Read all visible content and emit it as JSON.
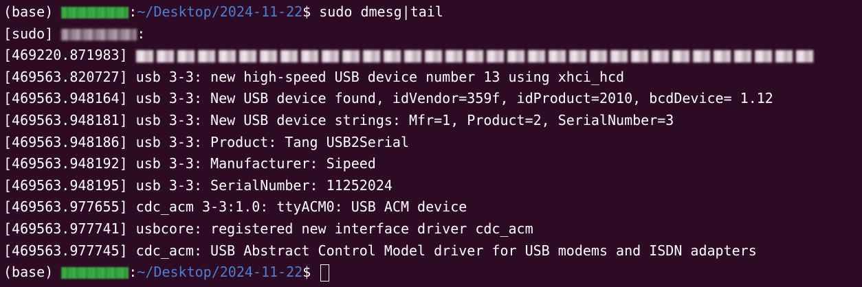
{
  "terminal": {
    "command_line": {
      "env": "(base) ",
      "path": "~/Desktop/2024-11-22",
      "symbol": "$ ",
      "command": "sudo dmesg|tail"
    },
    "sudo_prompt": {
      "prefix": "[sudo] ",
      "suffix": ":"
    },
    "redacted_log_timestamp": "[469220.871983] ",
    "log_lines": [
      "[469563.820727] usb 3-3: new high-speed USB device number 13 using xhci_hcd",
      "[469563.948164] usb 3-3: New USB device found, idVendor=359f, idProduct=2010, bcdDevice= 1.12",
      "[469563.948181] usb 3-3: New USB device strings: Mfr=1, Product=2, SerialNumber=3",
      "[469563.948186] usb 3-3: Product: Tang USB2Serial",
      "[469563.948192] usb 3-3: Manufacturer: Sipeed",
      "[469563.948195] usb 3-3: SerialNumber: 11252024",
      "[469563.977655] cdc_acm 3-3:1.0: ttyACM0: USB ACM device",
      "[469563.977741] usbcore: registered new interface driver cdc_acm",
      "[469563.977745] cdc_acm: USB Abstract Control Model driver for USB modems and ISDN adapters"
    ],
    "final_prompt": {
      "env": "(base) ",
      "path": "~/Desktop/2024-11-22",
      "symbol": "$ "
    },
    "colors": {
      "background": "#2e0b24",
      "text": "#ffffff",
      "path": "#4b7fd1",
      "user": "#32a43c"
    }
  }
}
